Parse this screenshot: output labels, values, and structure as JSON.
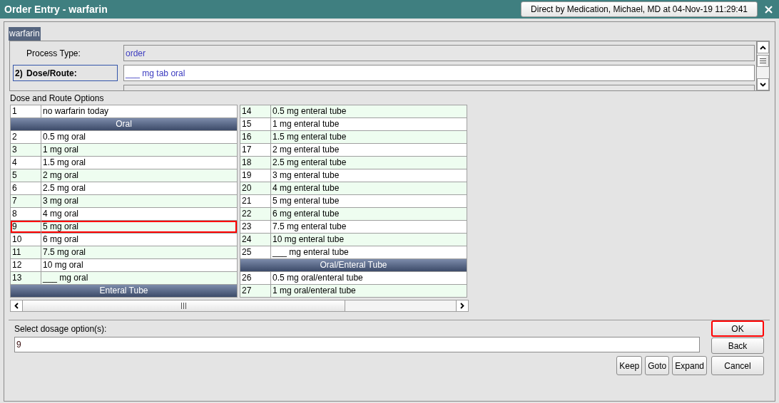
{
  "window": {
    "title": "Order Entry - warfarin",
    "user_button": "Direct by Medication, Michael, MD at 04-Nov-19 11:29:41"
  },
  "order_tab": {
    "label": "warfarin"
  },
  "details": [
    {
      "kind": "readonly",
      "label": "Process Type:",
      "value": "order"
    },
    {
      "kind": "active",
      "number": "2)",
      "label": "Dose/Route:",
      "value": "___ mg tab oral"
    },
    {
      "kind": "clipped"
    }
  ],
  "options": {
    "title": "Dose and Route Options",
    "columns": [
      [
        {
          "kind": "option",
          "number": "1",
          "label": "no warfarin today",
          "selected": false
        },
        {
          "kind": "group",
          "label": "Oral"
        },
        {
          "kind": "option",
          "number": "2",
          "label": "0.5 mg oral",
          "selected": false
        },
        {
          "kind": "option",
          "number": "3",
          "label": "1 mg oral",
          "selected": false
        },
        {
          "kind": "option",
          "number": "4",
          "label": "1.5 mg oral",
          "selected": false
        },
        {
          "kind": "option",
          "number": "5",
          "label": "2 mg oral",
          "selected": false
        },
        {
          "kind": "option",
          "number": "6",
          "label": "2.5 mg oral",
          "selected": false
        },
        {
          "kind": "option",
          "number": "7",
          "label": "3 mg oral",
          "selected": false
        },
        {
          "kind": "option",
          "number": "8",
          "label": "4 mg oral",
          "selected": false
        },
        {
          "kind": "option",
          "number": "9",
          "label": "5 mg oral",
          "selected": true
        },
        {
          "kind": "option",
          "number": "10",
          "label": "6 mg oral",
          "selected": false
        },
        {
          "kind": "option",
          "number": "11",
          "label": "7.5 mg oral",
          "selected": false
        },
        {
          "kind": "option",
          "number": "12",
          "label": "10 mg oral",
          "selected": false
        },
        {
          "kind": "option",
          "number": "13",
          "label": "___ mg oral",
          "selected": false
        },
        {
          "kind": "group",
          "label": "Enteral Tube"
        }
      ],
      [
        {
          "kind": "option",
          "number": "14",
          "label": "0.5 mg enteral tube",
          "selected": false
        },
        {
          "kind": "option",
          "number": "15",
          "label": "1 mg enteral tube",
          "selected": false
        },
        {
          "kind": "option",
          "number": "16",
          "label": "1.5 mg enteral tube",
          "selected": false
        },
        {
          "kind": "option",
          "number": "17",
          "label": "2 mg enteral tube",
          "selected": false
        },
        {
          "kind": "option",
          "number": "18",
          "label": "2.5 mg enteral tube",
          "selected": false
        },
        {
          "kind": "option",
          "number": "19",
          "label": "3 mg enteral tube",
          "selected": false
        },
        {
          "kind": "option",
          "number": "20",
          "label": "4 mg enteral tube",
          "selected": false
        },
        {
          "kind": "option",
          "number": "21",
          "label": "5 mg enteral tube",
          "selected": false
        },
        {
          "kind": "option",
          "number": "22",
          "label": "6 mg enteral tube",
          "selected": false
        },
        {
          "kind": "option",
          "number": "23",
          "label": "7.5 mg enteral tube",
          "selected": false
        },
        {
          "kind": "option",
          "number": "24",
          "label": "10 mg enteral tube",
          "selected": false
        },
        {
          "kind": "option",
          "number": "25",
          "label": "___ mg enteral tube",
          "selected": false
        },
        {
          "kind": "group",
          "label": "Oral/Enteral Tube"
        },
        {
          "kind": "option",
          "number": "26",
          "label": "0.5 mg oral/enteral tube",
          "selected": false
        },
        {
          "kind": "option",
          "number": "27",
          "label": "1 mg oral/enteral tube",
          "selected": false
        }
      ]
    ]
  },
  "selection": {
    "label": "Select dosage option(s):",
    "value": "9"
  },
  "side_buttons": [
    {
      "label": "OK",
      "highlighted": true
    },
    {
      "label": "Back",
      "highlighted": false
    }
  ],
  "action_buttons": [
    {
      "label": "Keep",
      "highlighted": false
    },
    {
      "label": "Goto",
      "highlighted": false
    },
    {
      "label": "Expand",
      "highlighted": false
    },
    {
      "label": "Cancel",
      "highlighted": false
    }
  ]
}
